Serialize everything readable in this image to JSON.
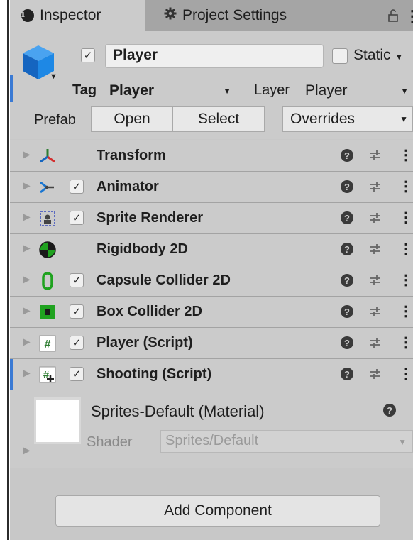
{
  "tabs": {
    "inspector": "Inspector",
    "project_settings": "Project Settings"
  },
  "header": {
    "object_name": "Player",
    "active": true,
    "static_label": "Static",
    "static_checked": false,
    "tag_label": "Tag",
    "tag_value": "Player",
    "layer_label": "Layer",
    "layer_value": "Player",
    "prefab_label": "Prefab",
    "open_button": "Open",
    "select_button": "Select",
    "overrides_dropdown": "Overrides"
  },
  "components": [
    {
      "name": "Transform",
      "icon": "transform-icon",
      "has_checkbox": false
    },
    {
      "name": "Animator",
      "icon": "animator-icon",
      "has_checkbox": true,
      "checked": true
    },
    {
      "name": "Sprite Renderer",
      "icon": "sprite-renderer-icon",
      "has_checkbox": true,
      "checked": true
    },
    {
      "name": "Rigidbody 2D",
      "icon": "rigidbody-icon",
      "has_checkbox": false
    },
    {
      "name": "Capsule Collider 2D",
      "icon": "capsule-collider-icon",
      "has_checkbox": true,
      "checked": true
    },
    {
      "name": "Box Collider 2D",
      "icon": "box-collider-icon",
      "has_checkbox": true,
      "checked": true
    },
    {
      "name": "Player (Script)",
      "icon": "script-icon",
      "has_checkbox": true,
      "checked": true
    },
    {
      "name": "Shooting (Script)",
      "icon": "script-add-icon",
      "has_checkbox": true,
      "checked": true
    }
  ],
  "material": {
    "name": "Sprites-Default (Material)",
    "shader_label": "Shader",
    "shader_value": "Sprites/Default"
  },
  "add_component_button": "Add Component",
  "colors": {
    "panel_bg": "#c8c8c8",
    "tab_bar": "#a5a5a5",
    "selection_accent": "#3a7ad4",
    "collider_green": "#1fa21f"
  }
}
